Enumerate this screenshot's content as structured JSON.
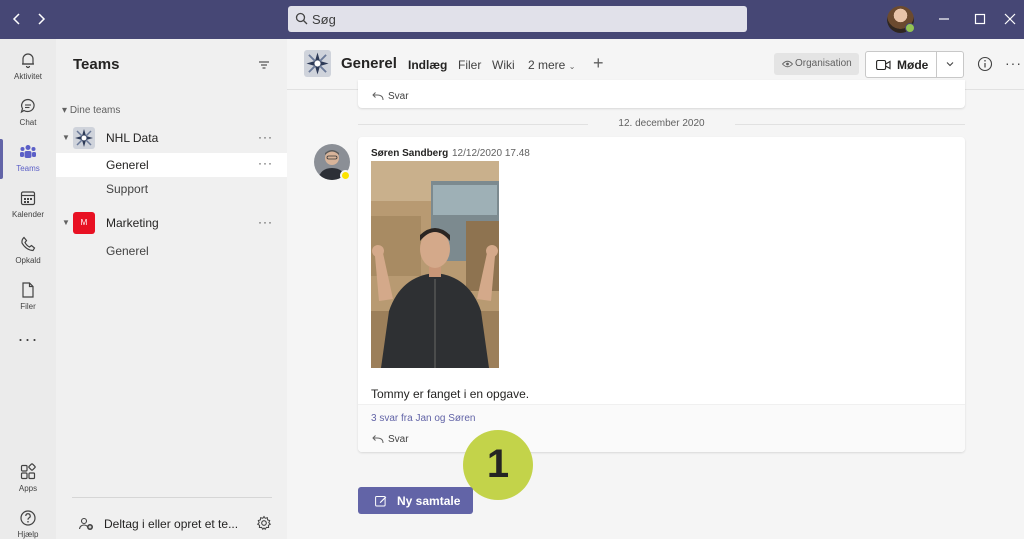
{
  "search": {
    "placeholder": "Søg"
  },
  "rail": {
    "items": [
      {
        "label": "Aktivitet",
        "icon": "bell-icon"
      },
      {
        "label": "Chat",
        "icon": "chat-icon"
      },
      {
        "label": "Teams",
        "icon": "teams-icon",
        "active": true
      },
      {
        "label": "Kalender",
        "icon": "calendar-icon"
      },
      {
        "label": "Opkald",
        "icon": "phone-icon"
      },
      {
        "label": "Filer",
        "icon": "file-icon"
      }
    ],
    "more": "···",
    "bottom": [
      {
        "label": "Apps",
        "icon": "apps-icon"
      },
      {
        "label": "Hjælp",
        "icon": "help-icon"
      }
    ]
  },
  "panel": {
    "title": "Teams",
    "section_label": "Dine teams",
    "teams": [
      {
        "name": "NHL Data",
        "channels": [
          "Generel",
          "Support"
        ]
      },
      {
        "name": "Marketing",
        "logo_letter": "M",
        "logo_color": "#e81123",
        "channels": [
          "Generel"
        ]
      }
    ],
    "join_label": "Deltag i eller opret et te..."
  },
  "header": {
    "channel": "Generel",
    "tabs": [
      "Indlæg",
      "Filer",
      "Wiki",
      "2 mere"
    ],
    "org_label": "Organisation",
    "meet_label": "Møde"
  },
  "feed": {
    "prev_reply_label": "Svar",
    "date_separator": "12. december 2020",
    "post": {
      "author": "Søren Sandberg",
      "time": "12/12/2020 17.48",
      "text": "Tommy er fanget i en opgave.",
      "replies": "3 svar fra Jan og Søren",
      "reply_label": "Svar"
    },
    "new_conversation": "Ny samtale",
    "callout_number": "1"
  },
  "colors": {
    "titlebar": "#464775",
    "accent": "#6264a7",
    "callout": "#c3d34a"
  }
}
